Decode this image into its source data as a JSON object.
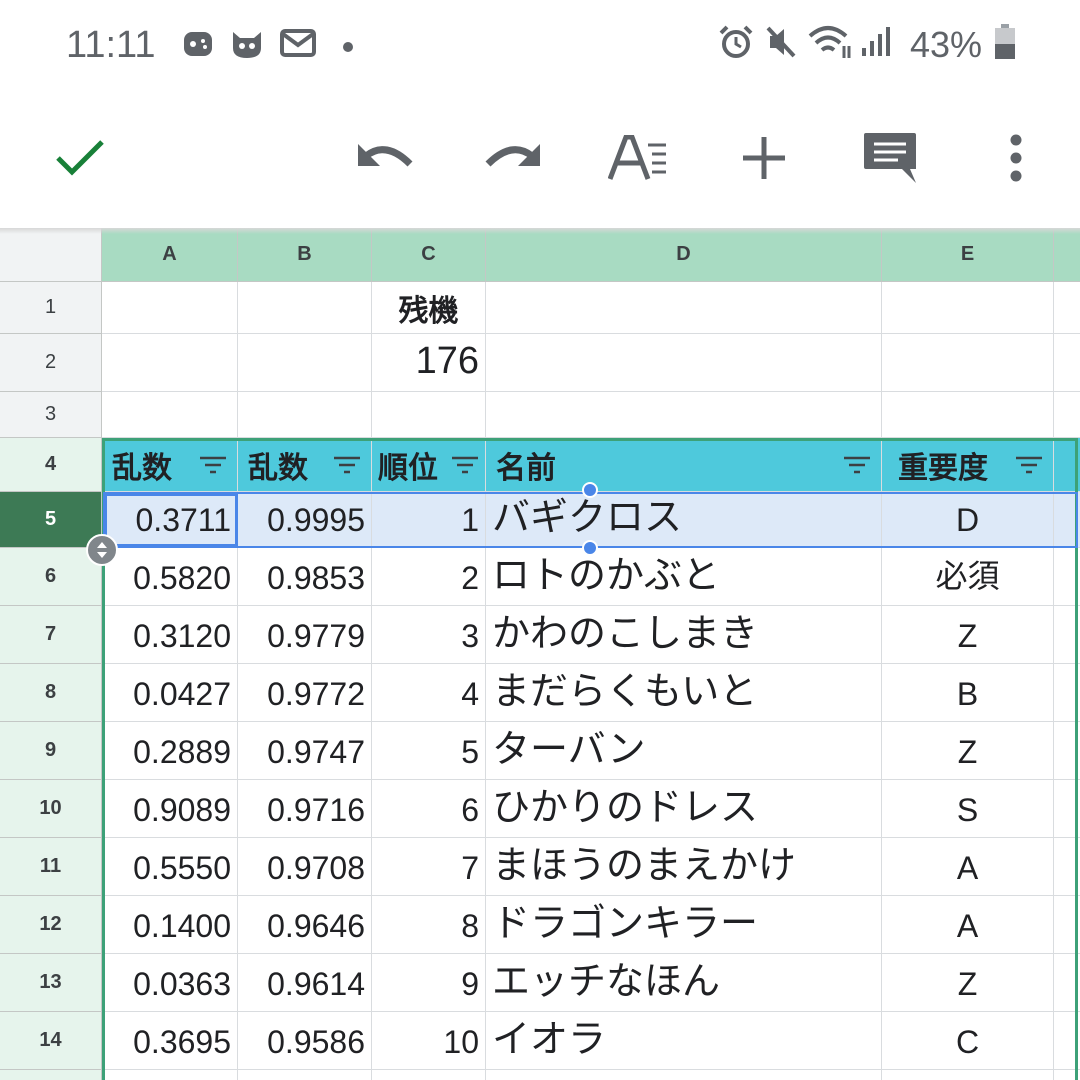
{
  "status_bar": {
    "time": "11:11",
    "battery": "43%",
    "notification_icons": [
      "game-icon",
      "cat-icon",
      "mail-icon",
      "dot-icon"
    ],
    "system_icons": [
      "alarm-icon",
      "mute-icon",
      "wifi-icon",
      "signal-icon",
      "battery-icon"
    ]
  },
  "toolbar": {
    "icons": [
      "check-icon",
      "undo-icon",
      "redo-icon",
      "text-format-icon",
      "add-icon",
      "comment-icon",
      "more-vert-icon"
    ]
  },
  "sheet": {
    "columns": [
      "A",
      "B",
      "C",
      "D",
      "E"
    ],
    "rows": [
      "1",
      "2",
      "3",
      "4",
      "5",
      "6",
      "7",
      "8",
      "9",
      "10",
      "11",
      "12",
      "13",
      "14"
    ],
    "selected_row": "5",
    "c1": "残機",
    "c2": "176",
    "table_headers": [
      "乱数",
      "乱数",
      "順位",
      "名前",
      "重要度"
    ],
    "data": [
      [
        "0.3711",
        "0.9995",
        "1",
        "バギクロス",
        "D"
      ],
      [
        "0.5820",
        "0.9853",
        "2",
        "ロトのかぶと",
        "必須"
      ],
      [
        "0.3120",
        "0.9779",
        "3",
        "かわのこしまき",
        "Z"
      ],
      [
        "0.0427",
        "0.9772",
        "4",
        "まだらくもいと",
        "B"
      ],
      [
        "0.2889",
        "0.9747",
        "5",
        "ターバン",
        "Z"
      ],
      [
        "0.9089",
        "0.9716",
        "6",
        "ひかりのドレス",
        "S"
      ],
      [
        "0.5550",
        "0.9708",
        "7",
        "まほうのまえかけ",
        "A"
      ],
      [
        "0.1400",
        "0.9646",
        "8",
        "ドラゴンキラー",
        "A"
      ],
      [
        "0.0363",
        "0.9614",
        "9",
        "エッチなほん",
        "Z"
      ],
      [
        "0.3695",
        "0.9586",
        "10",
        "イオラ",
        "C"
      ]
    ]
  },
  "colors": {
    "column_header_bg": "#a8dbc2",
    "table_header_bg": "#4ec9dc",
    "table_border": "#3da178",
    "selection": "#4a86e8",
    "selected_row_header": "#3d7a55",
    "check": "#188038"
  }
}
